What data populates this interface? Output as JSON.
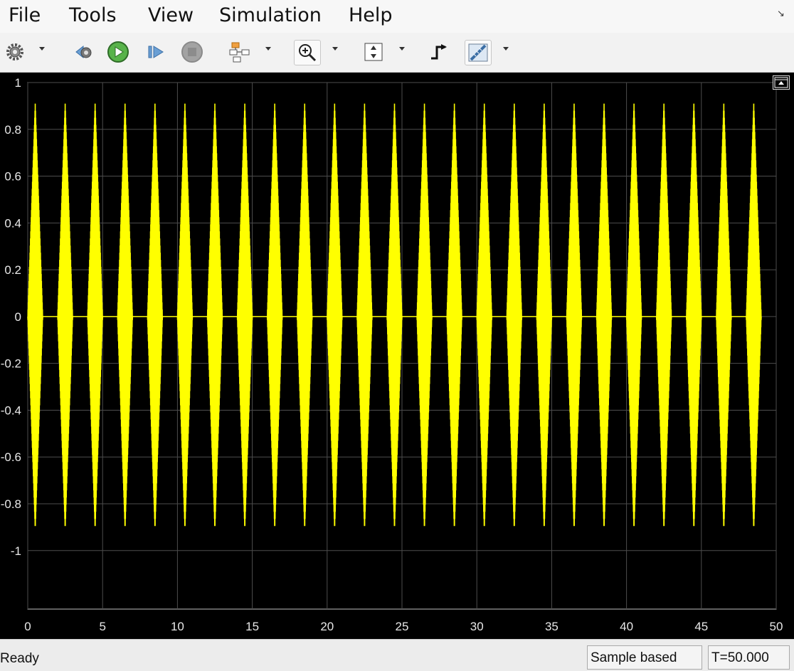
{
  "menu": {
    "items": [
      "File",
      "Tools",
      "View",
      "Simulation",
      "Help"
    ]
  },
  "toolbar": {
    "buttons": [
      {
        "name": "settings",
        "icon": "gear-icon"
      },
      {
        "name": "step-back",
        "icon": "step-back-icon"
      },
      {
        "name": "run",
        "icon": "play-icon"
      },
      {
        "name": "step-forward",
        "icon": "step-forward-icon"
      },
      {
        "name": "stop",
        "icon": "stop-icon"
      },
      {
        "name": "highlight-block",
        "icon": "highlight-block-icon"
      },
      {
        "name": "zoom",
        "icon": "zoom-in-icon"
      },
      {
        "name": "scale-axes",
        "icon": "scale-y-icon"
      },
      {
        "name": "triggers",
        "icon": "trigger-icon"
      },
      {
        "name": "measurements",
        "icon": "ruler-icon"
      }
    ]
  },
  "colors": {
    "plot_background": "#000000",
    "signal": "#ffff00",
    "grid": "#4d4d4d",
    "tick_text": "#e8e8e8"
  },
  "chart_data": {
    "type": "line",
    "title": "",
    "xlabel": "",
    "ylabel": "",
    "xlim": [
      0,
      50
    ],
    "ylim": [
      -1.25,
      1.0
    ],
    "xticks": [
      0,
      5,
      10,
      15,
      20,
      25,
      30,
      35,
      40,
      45,
      50
    ],
    "yticks": [
      1,
      0.8,
      0.6,
      0.4,
      0.2,
      0,
      -0.2,
      -0.4,
      -0.6,
      -0.8,
      -1
    ],
    "ytick_labels": [
      "1",
      "0.8",
      "0.6",
      "0.4",
      "0.2",
      "0",
      "-0.2",
      "-0.4",
      "-0.6",
      "-0.8",
      "-1"
    ],
    "grid": true,
    "series": [
      {
        "color": "#ffff00",
        "description_bursts": {
          "centers": [
            0.5,
            2.5,
            4.5,
            6.5,
            8.5,
            10.5,
            12.5,
            14.5,
            16.5,
            18.5,
            20.5,
            22.5,
            24.5,
            26.5,
            28.5,
            30.5,
            32.5,
            34.5,
            36.5,
            38.5,
            40.5,
            42.5,
            44.5,
            46.5,
            48.5
          ],
          "peak_amplitude": 0.91,
          "burst_halfwidth": 0.5,
          "baseline": 0
        }
      }
    ]
  },
  "status": {
    "ready": "Ready",
    "mode": "Sample based",
    "time": "T=50.000"
  }
}
